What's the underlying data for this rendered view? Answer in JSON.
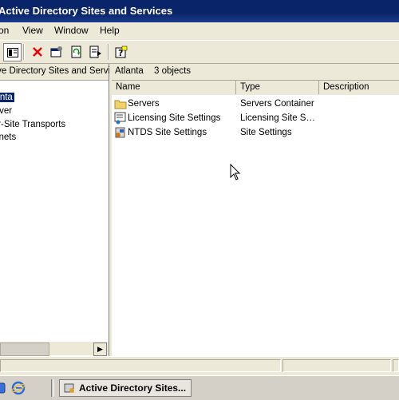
{
  "window": {
    "title": "Active Directory Sites and Services"
  },
  "menu": {
    "items": [
      "Action",
      "View",
      "Window",
      "Help"
    ]
  },
  "tree": {
    "root": "Active Directory Sites and Services [c",
    "items": [
      "Atlanta",
      "Denver",
      "Inter-Site Transports",
      "Subnets"
    ],
    "selected": "Atlanta"
  },
  "details": {
    "location": "Atlanta",
    "count": "3 objects",
    "columns": [
      "Name",
      "Type",
      "Description"
    ],
    "rows": [
      {
        "name": "Servers",
        "type": "Servers Container",
        "icon": "folder-icon"
      },
      {
        "name": "Licensing Site Settings",
        "type": "Licensing Site S…",
        "icon": "licensing-icon"
      },
      {
        "name": "NTDS Site Settings",
        "type": "Site Settings",
        "icon": "ntds-settings-icon"
      }
    ]
  },
  "taskbar": {
    "active_window": "Active Directory Sites..."
  }
}
